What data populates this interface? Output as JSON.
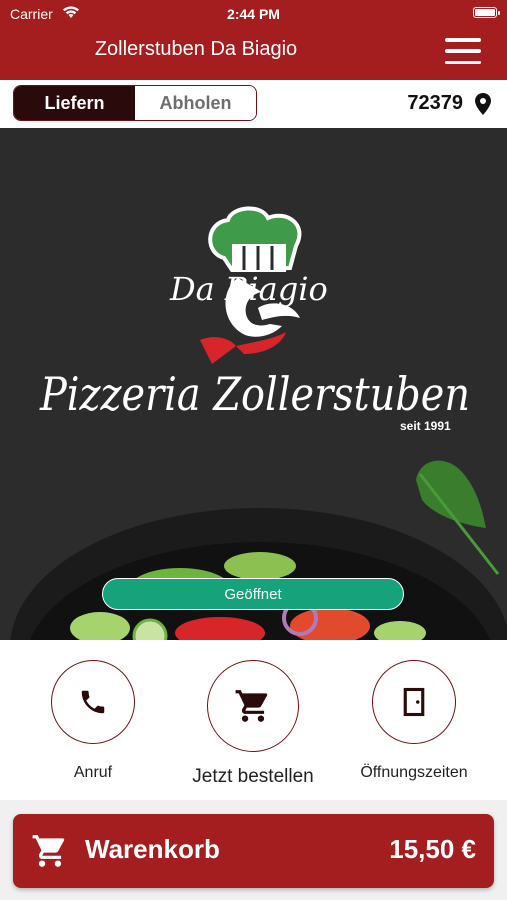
{
  "status_bar": {
    "carrier": "Carrier",
    "time": "2:44 PM",
    "battery_level": 0.9
  },
  "header": {
    "title": "Zollerstuben Da Biagio",
    "menu_icon": "hamburger-menu-icon"
  },
  "mode_toggle": {
    "deliver_label": "Liefern",
    "pickup_label": "Abholen",
    "selected": "Liefern"
  },
  "location": {
    "zip": "72379",
    "icon": "location-pin-icon"
  },
  "hero": {
    "logo_small": "Da Biagio",
    "logo_large": "Pizzeria Zollerstuben",
    "logo_since": "seit 1991",
    "status_badge": "Geöffnet"
  },
  "actions": [
    {
      "label": "Anruf",
      "icon": "phone-icon"
    },
    {
      "label": "Jetzt bestellen",
      "icon": "cart-icon"
    },
    {
      "label": "Öffnungszeiten",
      "icon": "door-icon"
    }
  ],
  "cart": {
    "label": "Warenkorb",
    "total": "15,50 €",
    "icon": "cart-icon"
  },
  "colors": {
    "brand_red": "#a41d1f",
    "dark": "#2a0a0b",
    "open_green": "#16a37c",
    "hero_bg": "#2c2c2c"
  }
}
